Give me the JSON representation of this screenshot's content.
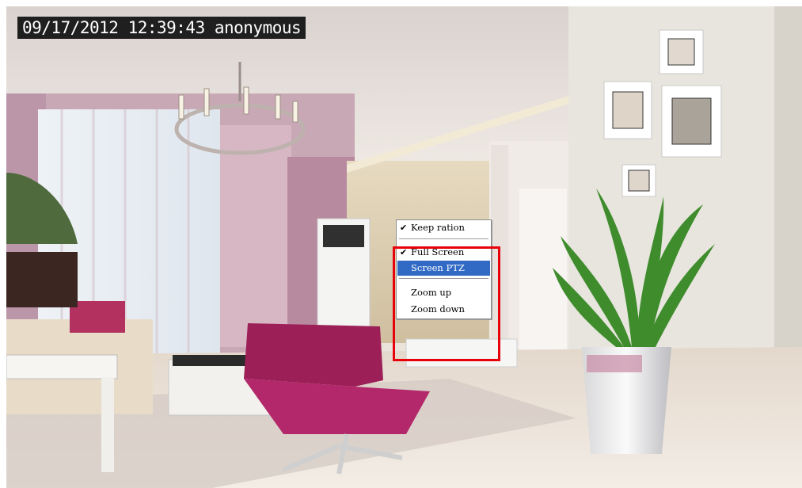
{
  "osd": {
    "text": "09/17/2012 12:39:43 anonymous"
  },
  "context_menu": {
    "items": [
      {
        "label": "Keep ration",
        "checked": true
      },
      {
        "label": "Full Screen",
        "checked": true
      },
      {
        "label": "Screen PTZ",
        "checked": false,
        "highlighted": true
      },
      {
        "label": "Zoom up",
        "checked": false
      },
      {
        "label": "Zoom down",
        "checked": false
      }
    ],
    "check_glyph": "✔"
  },
  "colors": {
    "menu_highlight": "#316ac5",
    "annotation_box": "#e8000b",
    "osd_background": "#1f1f1f"
  }
}
